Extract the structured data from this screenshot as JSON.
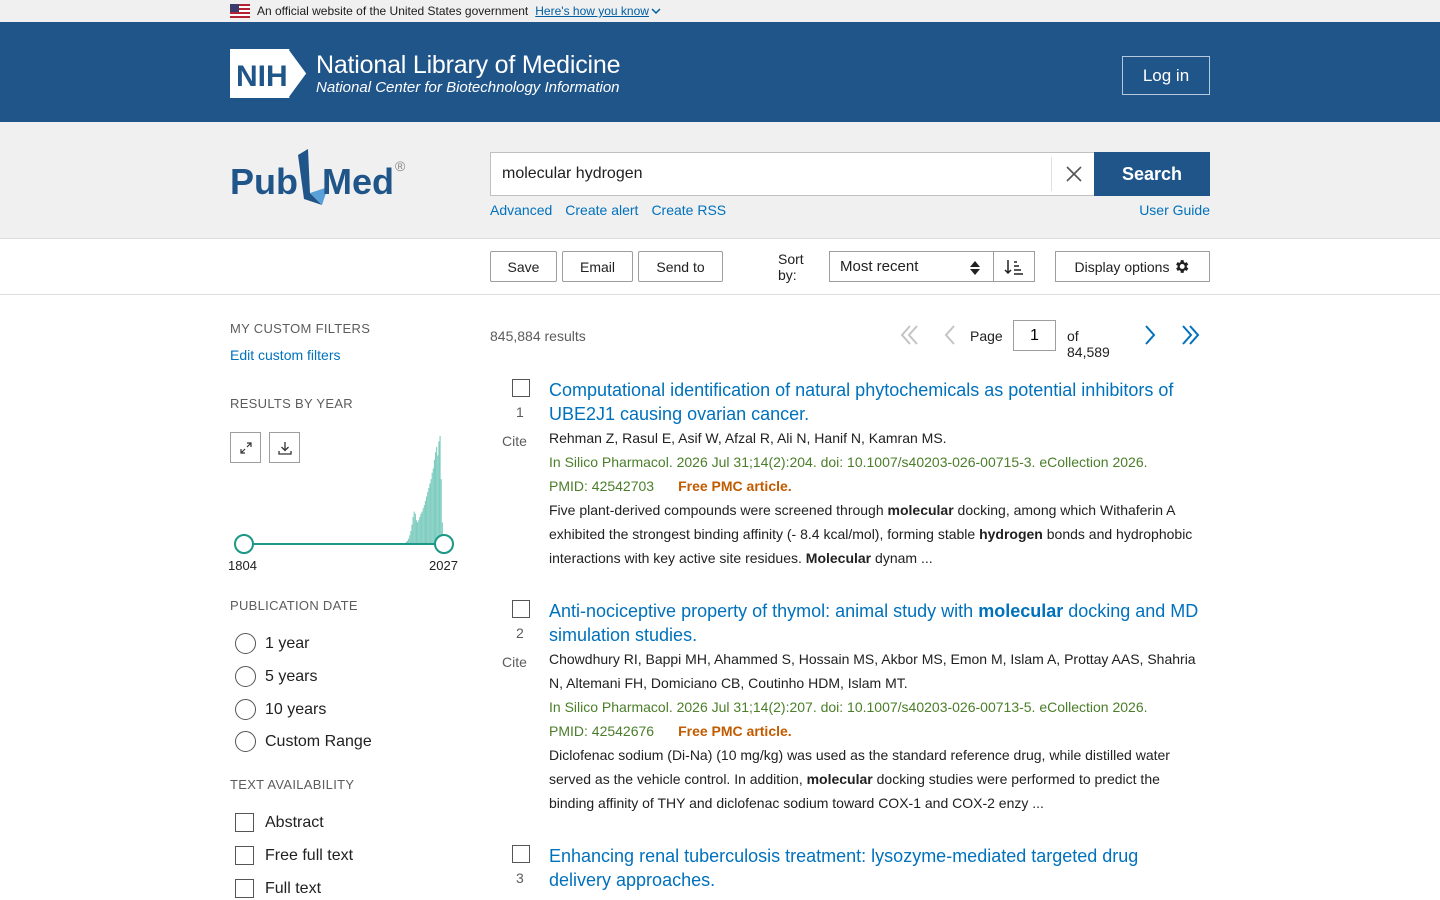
{
  "gov_banner": {
    "text": "An official website of the United States government",
    "link": "Here's how you know"
  },
  "nih": {
    "badge": "NIH",
    "title": "National Library of Medicine",
    "subtitle": "National Center for Biotechnology Information",
    "login": "Log in"
  },
  "search": {
    "logo_left": "Pub",
    "logo_right": "Med",
    "logo_mark": "®",
    "query": "molecular hydrogen",
    "button": "Search",
    "links": [
      "Advanced",
      "Create alert",
      "Create RSS"
    ],
    "user_guide": "User Guide"
  },
  "actions": {
    "save": "Save",
    "email": "Email",
    "send_to": "Send to",
    "sort_label": "Sort by:",
    "sort_value": "Most recent",
    "display_options": "Display options"
  },
  "sidebar": {
    "custom_filters_heading": "MY CUSTOM FILTERS",
    "edit_custom_filters": "Edit custom filters",
    "results_by_year_heading": "RESULTS BY YEAR",
    "year_start": "1804",
    "year_end": "2027",
    "publication_date_heading": "PUBLICATION DATE",
    "publication_dates": [
      "1 year",
      "5 years",
      "10 years",
      "Custom Range"
    ],
    "text_availability_heading": "TEXT AVAILABILITY",
    "text_availability": [
      "Abstract",
      "Free full text",
      "Full text"
    ]
  },
  "results_summary": {
    "count": "845,884 results",
    "page_label": "Page",
    "page_value": "1",
    "page_of": "of 84,589"
  },
  "results": [
    {
      "num": "1",
      "cite": "Cite",
      "title_html": "Computational identification of natural phytochemicals as potential inhibitors of UBE2J1 causing ovarian cancer.",
      "authors": "Rehman Z, Rasul E, Asif W, Afzal R, Ali N, Hanif N, Kamran MS.",
      "citation": "In Silico Pharmacol. 2026 Jul 31;14(2):204. doi: 10.1007/s40203-026-00715-3. eCollection 2026.",
      "pmid": "PMID: 42542703",
      "free": "Free PMC article.",
      "snippet_html": "Five plant-derived compounds were screened through <b>molecular</b> docking, among which Withaferin A exhibited the strongest binding affinity (- 8.4 kcal/mol), forming stable <b>hydrogen</b> bonds and hydrophobic interactions with key active site residues. <b>Molecular</b> dynam ..."
    },
    {
      "num": "2",
      "cite": "Cite",
      "title_html": "Anti-nociceptive property of thymol: animal study with <b>molecular</b> docking and MD simulation studies.",
      "authors": "Chowdhury RI, Bappi MH, Ahammed S, Hossain MS, Akbor MS, Emon M, Islam A, Prottay AAS, Shahria N, Altemani FH, Domiciano CB, Coutinho HDM, Islam MT.",
      "citation": "In Silico Pharmacol. 2026 Jul 31;14(2):207. doi: 10.1007/s40203-026-00713-5. eCollection 2026.",
      "pmid": "PMID: 42542676",
      "free": "Free PMC article.",
      "snippet_html": "Diclofenac sodium (Di-Na) (10 mg/kg) was used as the standard reference drug, while distilled water served as the vehicle control. In addition, <b>molecular</b> docking studies were performed to predict the binding affinity of THY and diclofenac sodium toward COX-1 and COX-2 enzy ..."
    },
    {
      "num": "3",
      "cite": "Cite",
      "title_html": "Enhancing renal tuberculosis treatment: lysozyme-mediated targeted drug delivery approaches.",
      "authors": "",
      "citation": "",
      "pmid": "",
      "free": "",
      "snippet_html": ""
    }
  ],
  "histogram": {
    "values": [
      0,
      0,
      0,
      0,
      0,
      0,
      0,
      0,
      0,
      0,
      0,
      0,
      0,
      0,
      0,
      0,
      0,
      0,
      0,
      0,
      0,
      0,
      0,
      0,
      0,
      0,
      0,
      0,
      0,
      0,
      0,
      0,
      0,
      0,
      0,
      0,
      0,
      0,
      0,
      0,
      0,
      0,
      0,
      0,
      0,
      0,
      0,
      0,
      0,
      0,
      0,
      0,
      0,
      0,
      0,
      0,
      0,
      0,
      0,
      0,
      0,
      0,
      0,
      0,
      0,
      0,
      0,
      0,
      0,
      0,
      0,
      0,
      0,
      0,
      0,
      0,
      0,
      0,
      0,
      0,
      0,
      0,
      0,
      0,
      0,
      0,
      0,
      0,
      0,
      0,
      0,
      0,
      0,
      0,
      0,
      0,
      0,
      0,
      0,
      0,
      0,
      0,
      0,
      0,
      0,
      0,
      0,
      0,
      0,
      0,
      0,
      0,
      0,
      0,
      0,
      0,
      0,
      0,
      0,
      0,
      0,
      0,
      0,
      0,
      0,
      0,
      0,
      0,
      0,
      0,
      0,
      0,
      0,
      0,
      0,
      0,
      0,
      0,
      0,
      0,
      0,
      0,
      0,
      0.01,
      0.02,
      0.03,
      0.05,
      0.08,
      0.12,
      0.18,
      0.25,
      0.3,
      0.28,
      0.22,
      0.2,
      0.22,
      0.25,
      0.28,
      0.3,
      0.33,
      0.36,
      0.4,
      0.44,
      0.48,
      0.52,
      0.56,
      0.6,
      0.66,
      0.7,
      0.78,
      0.85,
      0.9,
      0.82,
      0.95,
      1.0,
      0.6,
      0.2,
      0.05
    ],
    "color": "#7fcdc0"
  },
  "colors": {
    "brand_blue": "#20558a",
    "link_blue": "#0071bc",
    "citation_green": "#4b7e2a",
    "free_orange": "#c15b00",
    "slider_teal": "#1b9886"
  }
}
